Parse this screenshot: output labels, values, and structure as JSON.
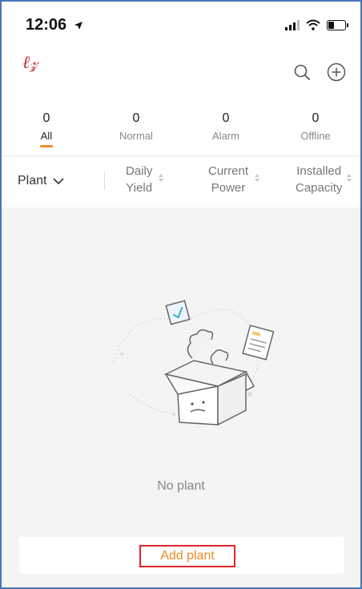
{
  "status_bar": {
    "time": "12:06"
  },
  "header": {
    "logo_text": "乂䒭"
  },
  "tabs": [
    {
      "count": "0",
      "label": "All"
    },
    {
      "count": "0",
      "label": "Normal"
    },
    {
      "count": "0",
      "label": "Alarm"
    },
    {
      "count": "0",
      "label": "Offline"
    }
  ],
  "list_header": {
    "plant_label": "Plant",
    "columns": [
      {
        "line1": "Daily",
        "line2": "Yield"
      },
      {
        "line1": "Current",
        "line2": "Power"
      },
      {
        "line1": "Installed",
        "line2": "Capacity"
      }
    ]
  },
  "empty_state": {
    "message": "No plant"
  },
  "actions": {
    "add_plant_label": "Add plant"
  },
  "colors": {
    "accent": "#f08a24",
    "highlight_box": "#e0242a",
    "logo": "#c1272d"
  },
  "icons": [
    "location-arrow-icon",
    "signal-icon",
    "wifi-icon",
    "battery-icon",
    "search-icon",
    "add-circle-icon",
    "chevron-down-icon",
    "sort-icon",
    "empty-box-illustration"
  ]
}
